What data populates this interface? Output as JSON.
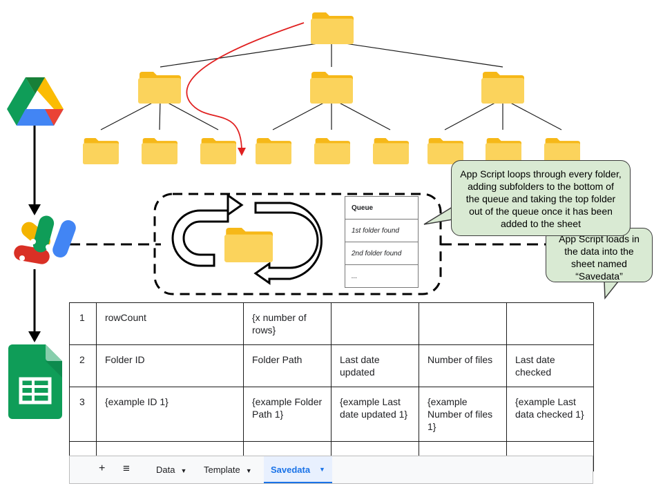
{
  "icons": {
    "drive": "google-drive-icon",
    "apps_script": "apps-script-icon",
    "sheets": "google-sheets-icon",
    "folder": "folder-icon"
  },
  "colors": {
    "folder": "#fbd35c",
    "folder_tab": "#f6b818",
    "callout_bg": "#d9ead3",
    "arrow_red": "#e02020",
    "active_tab": "#1a73e8",
    "active_tab_bg": "#e8f0fe"
  },
  "callouts": {
    "loop": "App Script loops through every folder, adding subfolders to the bottom of the queue and taking the top folder out of the queue once it has been added to the sheet",
    "loads": "App Script loads in the data into the sheet named “Savedata”"
  },
  "queue": {
    "header": "Queue",
    "items": [
      "1st folder found",
      "2nd folder found",
      "..."
    ]
  },
  "sheet": {
    "rows": [
      [
        "1",
        "rowCount",
        "{x number of rows}",
        "",
        "",
        ""
      ],
      [
        "2",
        "Folder ID",
        "Folder Path",
        "Last date updated",
        "Number of files",
        "Last date checked"
      ],
      [
        "3",
        "{example ID 1}",
        "{example Folder Path 1}",
        "{example Last date updated 1}",
        "{example Number of files 1}",
        "{example Last data checked 1}"
      ],
      [
        "",
        "…",
        "…",
        "…",
        "…",
        "…"
      ]
    ]
  },
  "sheet_tabs": {
    "add": "+",
    "menu": "≡",
    "tabs": [
      "Data",
      "Template",
      "Savedata"
    ],
    "active": "Savedata"
  }
}
